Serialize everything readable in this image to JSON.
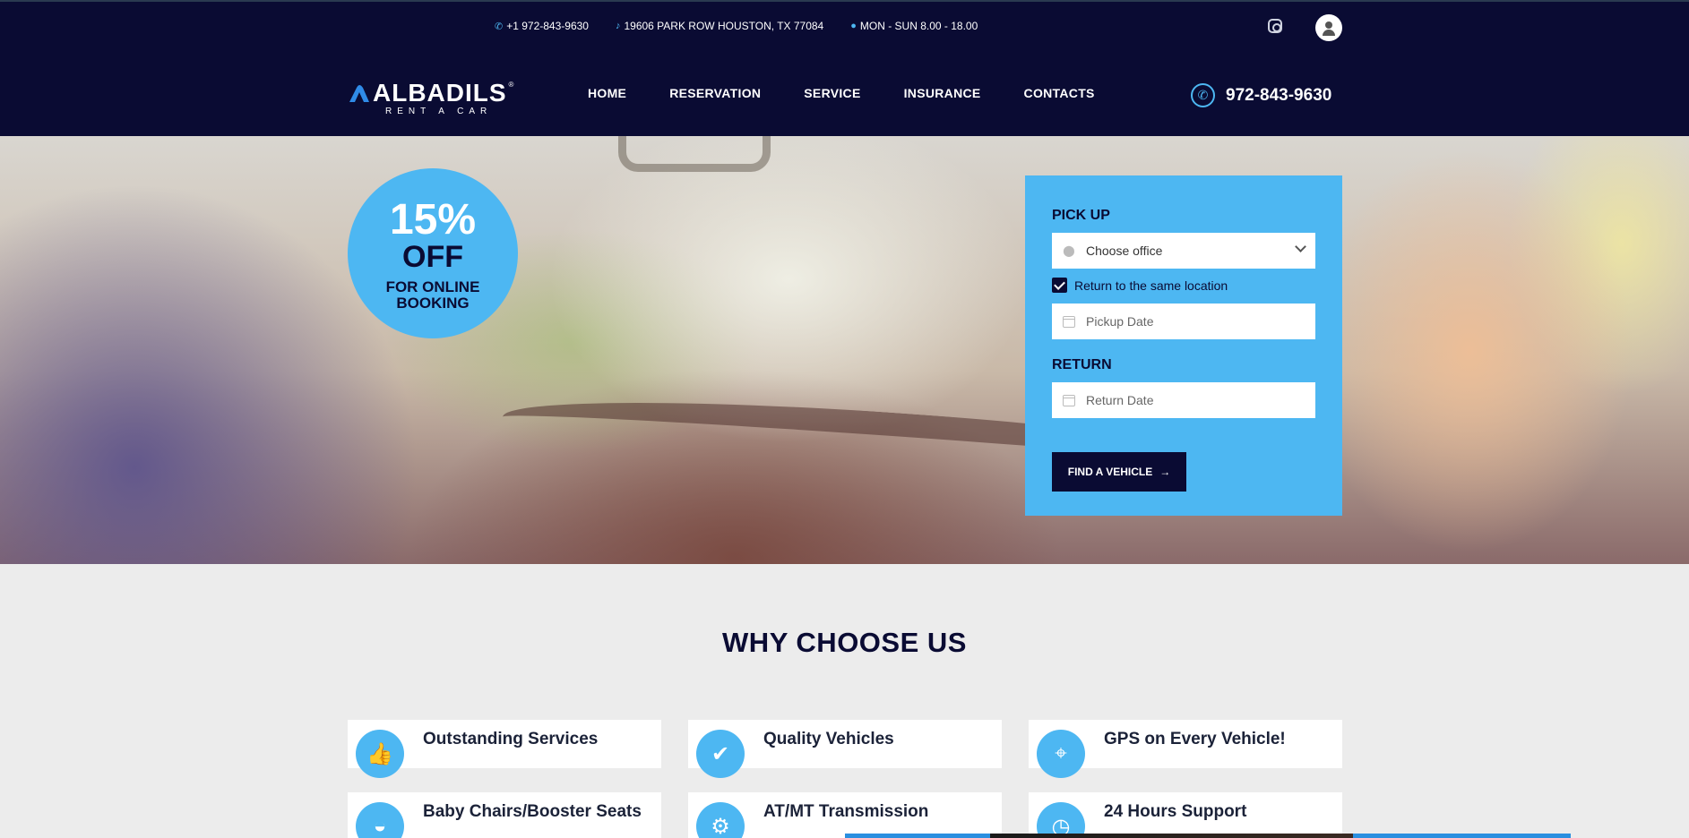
{
  "topbar": {
    "phone": "+1 972-843-9630",
    "address": "19606 PARK ROW HOUSTON, TX 77084",
    "hours": "MON - SUN 8.00 - 18.00",
    "social_icon": "instagram-icon",
    "user_icon": "user-icon"
  },
  "header": {
    "logo_name": "ALBADILS",
    "logo_reg": "®",
    "logo_sub": "RENT A CAR",
    "phone": "972-843-9630"
  },
  "nav": {
    "items": [
      {
        "label": "HOME"
      },
      {
        "label": "RESERVATION"
      },
      {
        "label": "SERVICE"
      },
      {
        "label": "INSURANCE"
      },
      {
        "label": "CONTACTS"
      }
    ]
  },
  "promo": {
    "percent": "15%",
    "off": "OFF",
    "line1": "FOR ONLINE",
    "line2": "BOOKING"
  },
  "booking": {
    "pickup_heading": "PICK UP",
    "office_select": "Choose office",
    "same_location_label": "Return to the same location",
    "same_location_checked": true,
    "pickup_date_placeholder": "Pickup Date",
    "return_heading": "RETURN",
    "return_date_placeholder": "Return Date",
    "find_button": "FIND A VEHICLE"
  },
  "why": {
    "heading": "WHY CHOOSE US",
    "features": [
      {
        "title": "Outstanding Services",
        "icon": "thumbs-up-icon"
      },
      {
        "title": "Quality Vehicles",
        "icon": "shield-check-icon"
      },
      {
        "title": "GPS on Every Vehicle!",
        "icon": "map-pin-icon"
      },
      {
        "title": "Baby Chairs/Booster Seats",
        "icon": "baby-carriage-icon"
      },
      {
        "title": "AT/MT Transmission",
        "icon": "gear-shift-icon"
      },
      {
        "title": "24 Hours Support",
        "icon": "clock-icon"
      }
    ]
  },
  "colors": {
    "navy": "#0a0b33",
    "accent": "#4db7f2"
  }
}
